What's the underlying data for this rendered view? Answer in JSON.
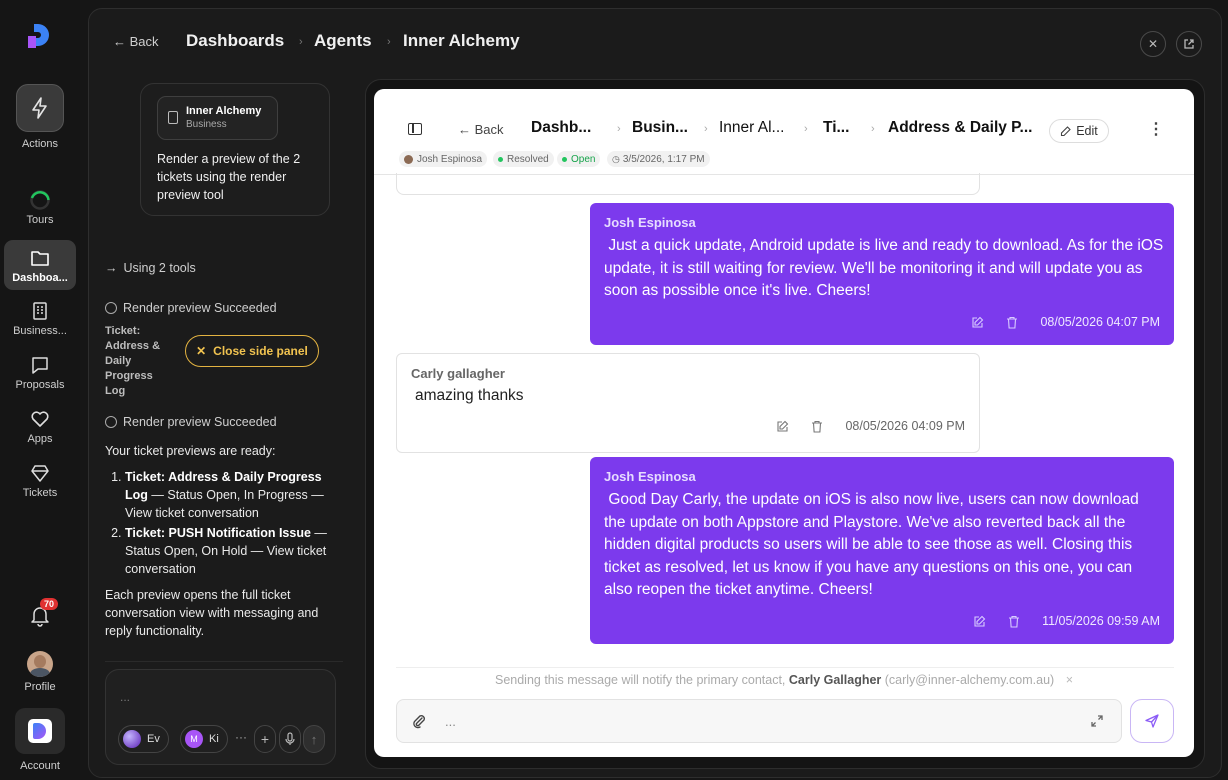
{
  "rail": {
    "items": [
      {
        "label": "Actions"
      },
      {
        "label": "Tours"
      },
      {
        "label": "Dashboa..."
      },
      {
        "label": "Business..."
      },
      {
        "label": "Proposals"
      },
      {
        "label": "Apps"
      },
      {
        "label": "Tickets"
      }
    ],
    "notifications_count": "70",
    "profile_label": "Profile",
    "account_label": "Account"
  },
  "header": {
    "back_label": "← Back",
    "breadcrumbs": [
      "Dashboards",
      "Agents",
      "Inner Alchemy"
    ],
    "separator": "›"
  },
  "chat": {
    "agent_chip": {
      "name": "Inner Alchemy",
      "type": "Business"
    },
    "user_message": "Render a preview of the 2 tickets using the render preview tool",
    "tools_line": "Using 2 tools",
    "tool_result_1": "Render preview Succeeded",
    "ticket_label": "Ticket: Address & Daily Progress Log",
    "close_panel_label": "Close side panel",
    "tool_result_2": "Render preview Succeeded",
    "ready_intro": "Your ticket previews are ready:",
    "ready_items": [
      {
        "title": "Ticket: Address & Daily Progress Log",
        "rest": " — Status Open, In Progress — View ticket conversation"
      },
      {
        "title": "Ticket: PUSH Notification Issue",
        "rest": " — Status Open, On Hold — View ticket conversation"
      }
    ],
    "ready_footer": "Each preview opens the full ticket conversation view with messaging and reply functionality.",
    "composer": {
      "placeholder": "...",
      "pill_1": "Ev",
      "pill_2_initial": "M",
      "pill_2": "Ki",
      "more": "···"
    }
  },
  "preview": {
    "back_label": "← Back",
    "breadcrumbs": [
      "Dashb...",
      "Busin...",
      "Inner Al...",
      "Ti...",
      "Address & Daily P..."
    ],
    "edit_label": "Edit",
    "meta": {
      "assignee": "Josh Espinosa",
      "status_1": "Resolved",
      "status_2": "Open",
      "datetime": "3/5/2026, 1:17 PM"
    },
    "messages": [
      {
        "author": "Josh Espinosa",
        "body": " Just a quick update, Android update is live and ready to download. As for the iOS update, it is still waiting for review. We'll be monitoring it and will update you as soon as possible once it's live. Cheers!",
        "timestamp": "08/05/2026 04:07 PM"
      },
      {
        "author": "Carly gallagher",
        "body": "amazing thanks",
        "timestamp": "08/05/2026 04:09 PM"
      },
      {
        "author": "Josh Espinosa",
        "body": " Good Day Carly, the update on iOS is also now live, users can now download the update on both Appstore and Playstore. We've also reverted back all the hidden digital products so users will be able to see those as well. Closing this ticket as resolved, let us know if you have any questions on this one, you can also reopen the ticket anytime. Cheers!",
        "timestamp": "11/05/2026 09:59 AM"
      }
    ],
    "notify": {
      "prefix": "Sending this message will notify the primary contact, ",
      "contact_name": "Carly Gallagher",
      "contact_email": " (carly@inner-alchemy.com.au)",
      "dismiss": "×"
    },
    "reply_placeholder": "..."
  },
  "colors": {
    "accent_purple": "#7c3aed",
    "warning_yellow": "#e3b341",
    "resolved_green": "#22c55e",
    "badge_red": "#e03131"
  }
}
